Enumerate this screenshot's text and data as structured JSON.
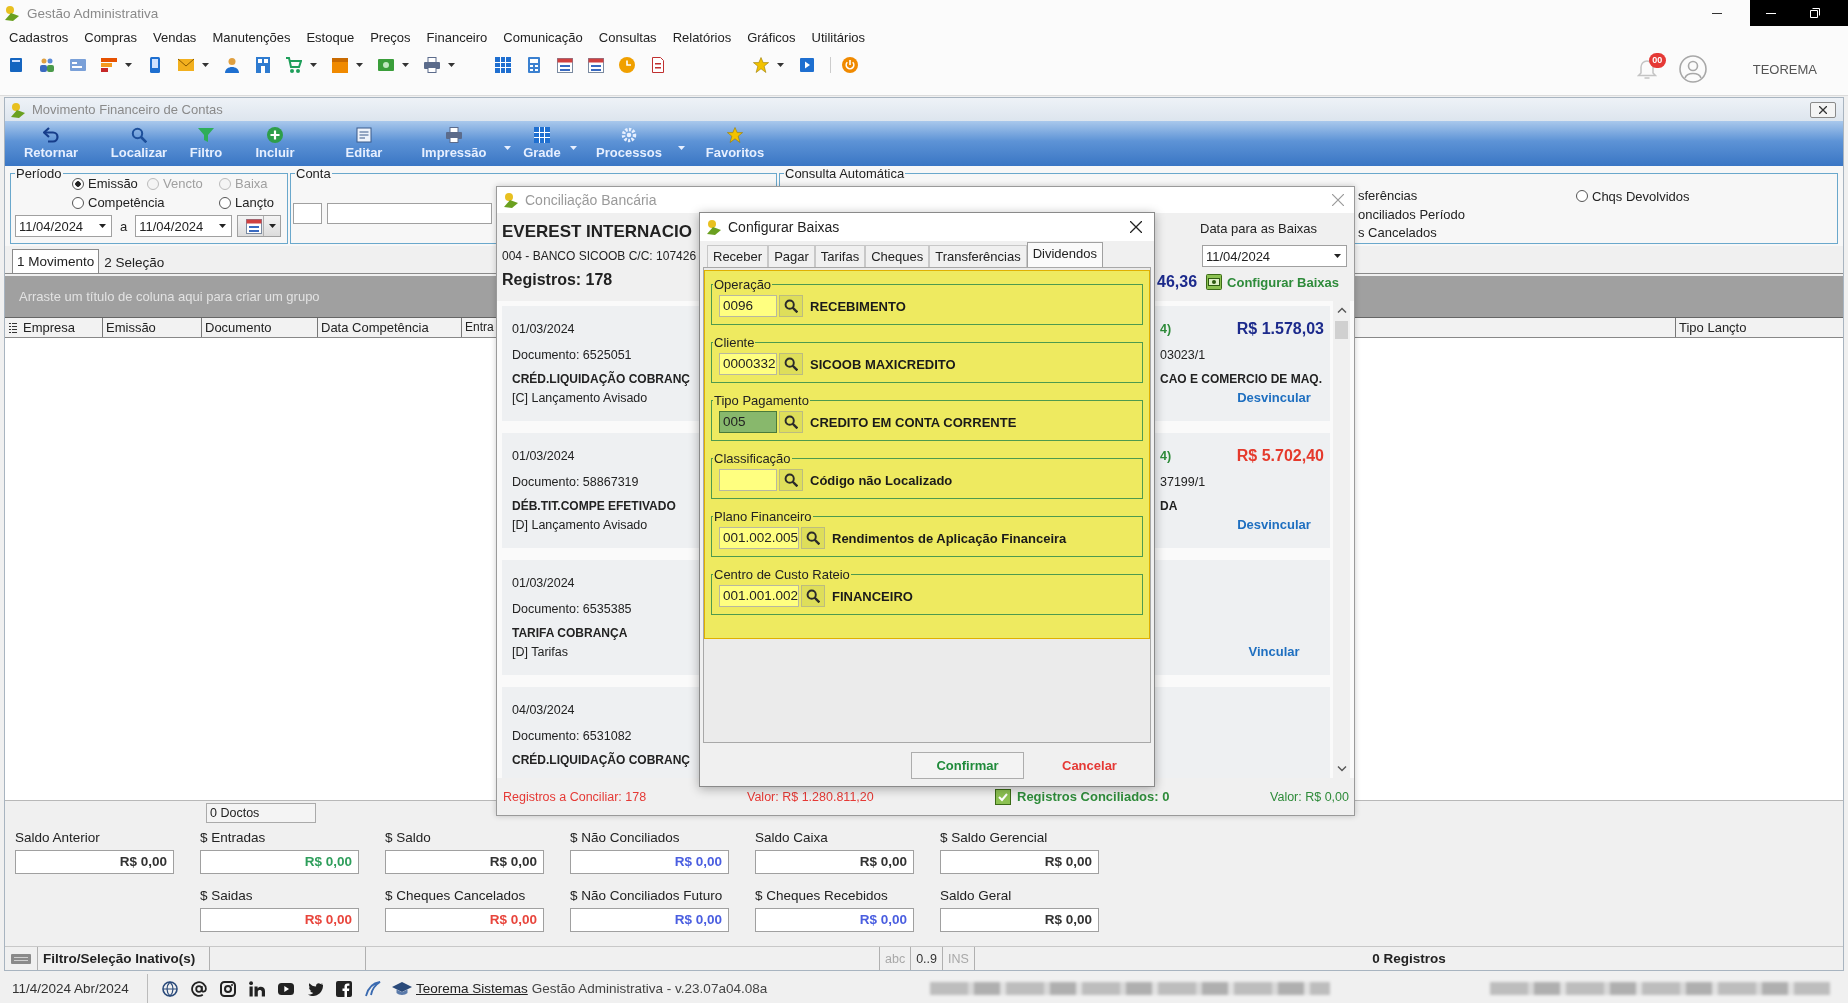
{
  "app_window": {
    "title": "Gestão Administrativa"
  },
  "menu": [
    "Cadastros",
    "Compras",
    "Vendas",
    "Manutenções",
    "Estoque",
    "Preços",
    "Financeiro",
    "Comunicação",
    "Consultas",
    "Relatórios",
    "Gráficos",
    "Utilitários"
  ],
  "user": {
    "notifications": "00",
    "name": "TEOREMA"
  },
  "form": {
    "title": "Movimento Financeiro de Contas",
    "toolbar": [
      {
        "label": "Retornar",
        "kind": "button"
      },
      {
        "label": "Localizar",
        "kind": "button"
      },
      {
        "label": "Filtro",
        "kind": "button"
      },
      {
        "label": "Incluir",
        "kind": "button"
      },
      {
        "label": "Editar",
        "kind": "button"
      },
      {
        "label": "Impressão",
        "kind": "dropdown"
      },
      {
        "label": "Grade",
        "kind": "dropdown"
      },
      {
        "label": "Processos",
        "kind": "dropdown"
      },
      {
        "label": "Favoritos",
        "kind": "button"
      }
    ],
    "period": {
      "legend": "Período",
      "options": [
        {
          "label": "Emissão",
          "selected": true,
          "disabled": false
        },
        {
          "label": "Vencto",
          "selected": false,
          "disabled": true
        },
        {
          "label": "Baixa",
          "selected": false,
          "disabled": true
        },
        {
          "label": "Competência",
          "selected": false,
          "disabled": false
        },
        {
          "label": "Lançto",
          "selected": false,
          "disabled": false
        }
      ],
      "date_from": "11/04/2024",
      "separator": "a",
      "date_to": "11/04/2024"
    },
    "account": {
      "legend": "Conta"
    },
    "auto_query": {
      "legend": "Consulta Automática",
      "partial_labels": [
        "sferências",
        "onciliados Período",
        "s Cancelados"
      ],
      "options": [
        {
          "label": "Chqs Devolvidos",
          "selected": false
        }
      ]
    },
    "tabs": [
      {
        "label": "1 Movimento",
        "selected": true
      },
      {
        "label": "2 Seleção",
        "selected": false
      }
    ],
    "group_hint": "Arraste um título de coluna aqui para criar um grupo",
    "columns": [
      "Empresa",
      "Emissão",
      "Documento",
      "Data Competência",
      "Entra",
      "Tipo Lançto"
    ],
    "doc_count": "0 Doctos",
    "totals": {
      "row_1": [
        {
          "label": "Saldo Anterior",
          "value": "R$ 0,00",
          "color": "#333333"
        },
        {
          "label": "$ Entradas",
          "value": "R$ 0,00",
          "color": "#2e9e5b"
        },
        {
          "label": "$ Saldo",
          "value": "R$ 0,00",
          "color": "#333333"
        },
        {
          "label": "$ Não Conciliados",
          "value": "R$ 0,00",
          "color": "#4a5ee0"
        },
        {
          "label": "Saldo Caixa",
          "value": "R$ 0,00",
          "color": "#333333"
        },
        {
          "label": "$ Saldo Gerencial",
          "value": "R$ 0,00",
          "color": "#333333"
        }
      ],
      "row_2": [
        {
          "label": "$ Saidas",
          "value": "R$ 0,00",
          "color": "#e8453c"
        },
        {
          "label": "$ Cheques Cancelados",
          "value": "R$ 0,00",
          "color": "#e8453c"
        },
        {
          "label": "$ Não Conciliados Futuro",
          "value": "R$ 0,00",
          "color": "#4a5ee0"
        },
        {
          "label": "$ Cheques Recebidos",
          "value": "R$ 0,00",
          "color": "#4a5ee0"
        },
        {
          "label": "Saldo Geral",
          "value": "R$ 0,00",
          "color": "#333333"
        }
      ]
    },
    "status_bar": {
      "filter": "Filtro/Seleção Inativo(s)",
      "indicators": [
        {
          "label": "abc",
          "on": false
        },
        {
          "label": "0..9",
          "on": true
        },
        {
          "label": "INS",
          "on": false
        }
      ],
      "records": "0 Registros"
    }
  },
  "footer": {
    "date": "11/4/2024 Abr/2024",
    "link": "Teorema Sistemas",
    "version": "Gestão Administrativa - v.23.07a04.08a"
  },
  "reconciliation": {
    "title": "Conciliação Bancária",
    "company": "EVEREST INTERNACIO",
    "account": "004 - BANCO SICOOB C/C: 107426",
    "records": "Registros: 178",
    "date_label": "Data para as Baixas",
    "date": "11/04/2024",
    "balance": "46,36",
    "configure_link": "Configurar Baixas",
    "entries": [
      {
        "date": "01/03/2024",
        "document": "Documento: 6525051",
        "description": "CRÉD.LIQUIDAÇÃO COBRANÇ",
        "type": "[C] Lançamento Avisado",
        "match": {
          "ref": "4)",
          "amount": "R$ 1.578,03",
          "color": "#1c2a8c",
          "document": "03023/1",
          "name": "CAO E COMERCIO DE MAQ.",
          "action": "Desvincular"
        }
      },
      {
        "date": "01/03/2024",
        "document": "Documento: 58867319",
        "description": "DÉB.TIT.COMPE EFETIVADO",
        "type": "[D] Lançamento Avisado",
        "match": {
          "ref": "4)",
          "amount": "R$ 5.702,40",
          "color": "#e53a2c",
          "document": "37199/1",
          "name": "DA",
          "action": "Desvincular"
        }
      },
      {
        "date": "01/03/2024",
        "document": "Documento: 6535385",
        "description": "TARIFA COBRANÇA",
        "type": "[D] Tarifas",
        "match": {
          "action": "Vincular"
        }
      },
      {
        "date": "04/03/2024",
        "document": "Documento: 6531082",
        "description": "CRÉD.LIQUIDAÇÃO COBRANÇ"
      }
    ],
    "footer": {
      "pending": "Registros a Conciliar: 178",
      "pending_value": "Valor: R$ 1.280.811,20",
      "reconciled": "Registros Conciliados: 0",
      "reconciled_value": "Valor: R$ 0,00"
    }
  },
  "settle_dialog": {
    "title": "Configurar Baixas",
    "tabs": [
      {
        "label": "Receber",
        "selected": false
      },
      {
        "label": "Pagar",
        "selected": false
      },
      {
        "label": "Tarifas",
        "selected": false
      },
      {
        "label": "Cheques",
        "selected": false
      },
      {
        "label": "Transferências",
        "selected": false
      },
      {
        "label": "Dividendos",
        "selected": true
      }
    ],
    "fields": [
      {
        "label": "Operação",
        "code": "0096",
        "description": "RECEBIMENTO",
        "focused": false
      },
      {
        "label": "Cliente",
        "code": "0000332",
        "description": "SICOOB MAXICREDITO",
        "focused": false
      },
      {
        "label": "Tipo Pagamento",
        "code": "005",
        "description": "CREDITO EM CONTA CORRENTE",
        "focused": true
      },
      {
        "label": "Classificação",
        "description": "Código não Localizado",
        "focused": false
      },
      {
        "label": "Plano Financeiro",
        "code": "001.002.005",
        "description": "Rendimentos de Aplicação Financeira",
        "focused": false
      },
      {
        "label": "Centro de Custo Rateio",
        "code": "001.001.002",
        "description": "FINANCEIRO",
        "focused": false
      }
    ],
    "confirm": "Confirmar",
    "cancel": "Cancelar"
  }
}
